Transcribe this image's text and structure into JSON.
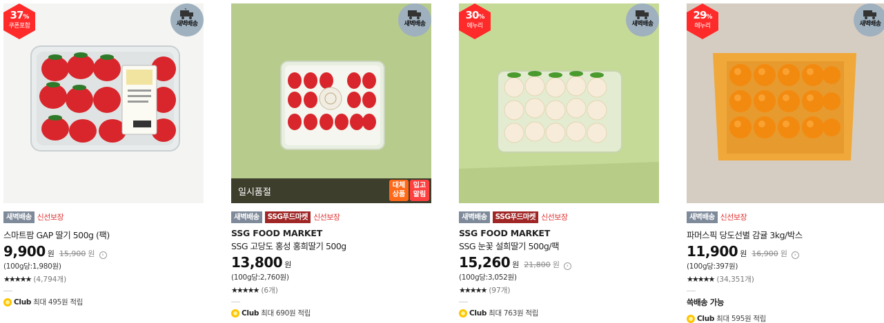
{
  "products": [
    {
      "discount_badge": {
        "pct": "37",
        "pct_unit": "%",
        "sub": "쿠폰포함"
      },
      "dawn_badge": "새벽배송",
      "tags": [
        {
          "label": "새벽배송",
          "style": "gray"
        }
      ],
      "tag_text": "신선보장",
      "brand": "",
      "name": "스마트팜 GAP 딸기 500g (팩)",
      "price": "9,900",
      "won": "원",
      "orig_price": "15,900",
      "orig_won": "원",
      "unit_price": "(100g당:1,980원)",
      "stars": "★★★★★",
      "review_count": "(4,794개)",
      "extra": "",
      "club": {
        "brand": "Club",
        "text": "최대 495원 적립"
      },
      "image_icon": "strawberry-pack-image"
    },
    {
      "discount_badge": null,
      "dawn_badge": "새벽배송",
      "tags": [
        {
          "label": "새벽배송",
          "style": "gray"
        },
        {
          "label": "SSG푸드마켓",
          "style": "red"
        }
      ],
      "tag_text": "신선보장",
      "brand": "SSG FOOD MARKET",
      "name": "SSG 고당도 홍성 홍희딸기 500g",
      "price": "13,800",
      "won": "원",
      "orig_price": "",
      "orig_won": "",
      "unit_price": "(100g당:2,760원)",
      "stars": "★★★★★",
      "review_count": "(6개)",
      "extra": "",
      "soldout": {
        "text": "일시품절",
        "substitute": "대체\n상품",
        "alarm": "입고\n알림"
      },
      "club": {
        "brand": "Club",
        "text": "최대 690원 적립"
      },
      "image_icon": "strawberry-tray-image"
    },
    {
      "discount_badge": {
        "pct": "30",
        "pct_unit": "%",
        "sub": "에누리"
      },
      "dawn_badge": "새벽배송",
      "tags": [
        {
          "label": "새벽배송",
          "style": "gray"
        },
        {
          "label": "SSG푸드마켓",
          "style": "red"
        }
      ],
      "tag_text": "신선보장",
      "brand": "SSG FOOD MARKET",
      "name": "SSG 눈꽃 설희딸기 500g/팩",
      "price": "15,260",
      "won": "원",
      "orig_price": "21,800",
      "orig_won": "원",
      "unit_price": "(100g당:3,052원)",
      "stars": "★★★★★",
      "review_count": "(97개)",
      "extra": "",
      "club": {
        "brand": "Club",
        "text": "최대 763원 적립"
      },
      "image_icon": "white-strawberry-image"
    },
    {
      "discount_badge": {
        "pct": "29",
        "pct_unit": "%",
        "sub": "에누리"
      },
      "dawn_badge": "새벽배송",
      "tags": [
        {
          "label": "새벽배송",
          "style": "gray"
        }
      ],
      "tag_text": "신선보장",
      "brand": "",
      "name": "파머스픽 당도선별 감귤 3kg/박스",
      "price": "11,900",
      "won": "원",
      "orig_price": "16,900",
      "orig_won": "원",
      "unit_price": "(100g당:397원)",
      "stars": "★★★★★",
      "review_count": "(34,351개)",
      "extra": "쓱배송 가능",
      "club": {
        "brand": "Club",
        "text": "최대 595원 적립"
      },
      "image_icon": "tangerine-box-image"
    }
  ],
  "colors": {
    "discount": "#ff2a2a",
    "tag_gray": "#7e8a9a",
    "tag_red": "#a02626",
    "fresh": "#e03030",
    "club_coin": "#ffc400"
  }
}
